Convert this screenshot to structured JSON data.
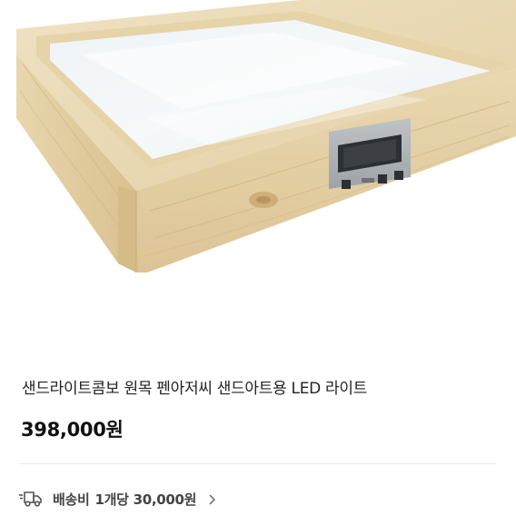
{
  "product": {
    "title": "샌드라이트콤보 원목 펜아저씨 샌드아트용 LED 라이트",
    "price": "398,000원"
  },
  "shipping": {
    "label": "배송비",
    "value": "1개당 30,000원"
  },
  "colors": {
    "background": "#ffffff",
    "text_primary": "#222222",
    "text_secondary": "#444444",
    "divider": "#e9e9e9"
  },
  "icons": {
    "shipping": "truck-icon",
    "more": "chevron-right-icon"
  }
}
